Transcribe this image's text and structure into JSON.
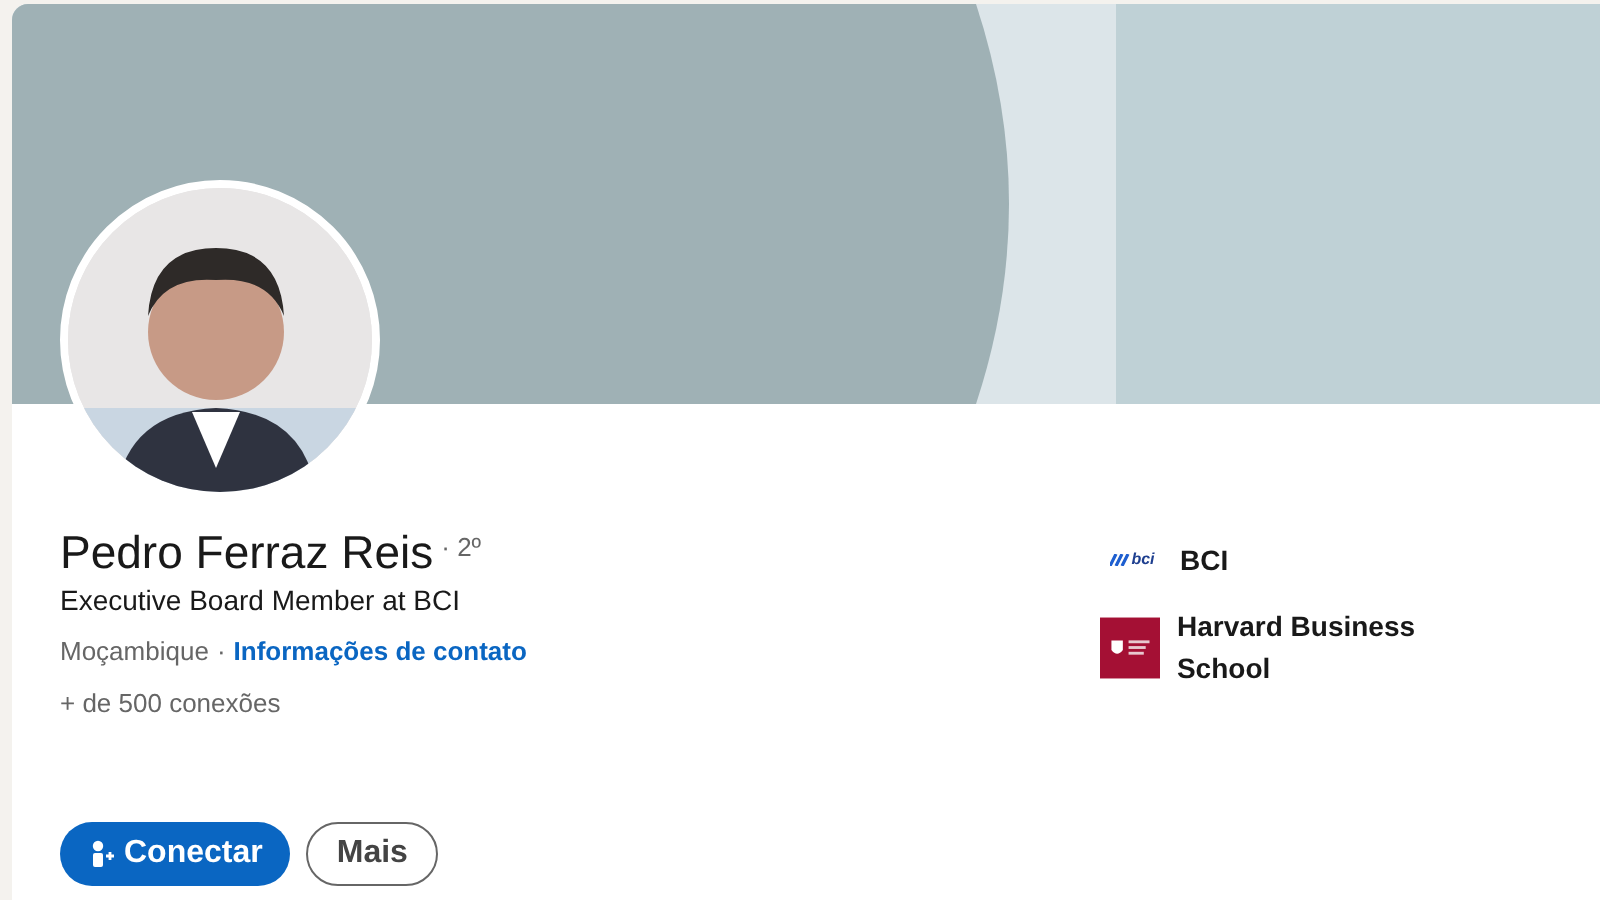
{
  "profile": {
    "name": "Pedro Ferraz Reis",
    "degree": "· 2º",
    "headline": "Executive Board Member at BCI",
    "location": "Moçambique",
    "separator": "·",
    "contact_link": "Informações de contato",
    "connections": "+ de 500 conexões"
  },
  "experience": [
    {
      "kind": "bci",
      "logo_text": "bci",
      "label": "BCI"
    },
    {
      "kind": "school",
      "label": "Harvard Business School"
    }
  ],
  "actions": [
    {
      "kind": "primary",
      "label": "Conectar"
    },
    {
      "kind": "secondary",
      "label": "Mais"
    }
  ]
}
